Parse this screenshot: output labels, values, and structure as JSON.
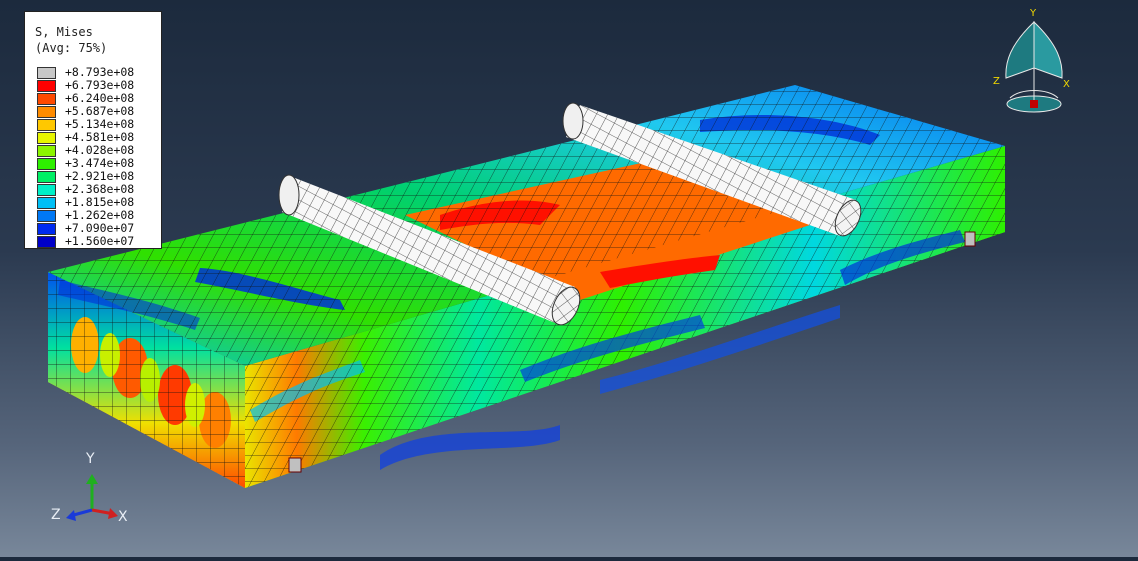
{
  "legend": {
    "title": "S, Mises",
    "subtitle": "(Avg: 75%)",
    "entries": [
      {
        "label": "+8.793e+08",
        "color": "#c8c8c8"
      },
      {
        "label": "+6.793e+08",
        "color": "#ff0000"
      },
      {
        "label": "+6.240e+08",
        "color": "#ff4a00"
      },
      {
        "label": "+5.687e+08",
        "color": "#ff8c00"
      },
      {
        "label": "+5.134e+08",
        "color": "#ffc800"
      },
      {
        "label": "+4.581e+08",
        "color": "#e6f500"
      },
      {
        "label": "+4.028e+08",
        "color": "#8cf500"
      },
      {
        "label": "+3.474e+08",
        "color": "#2ef000"
      },
      {
        "label": "+2.921e+08",
        "color": "#00f065"
      },
      {
        "label": "+2.368e+08",
        "color": "#00f0c8"
      },
      {
        "label": "+1.815e+08",
        "color": "#00bff5"
      },
      {
        "label": "+1.262e+08",
        "color": "#0078f5"
      },
      {
        "label": "+7.090e+07",
        "color": "#002bf0"
      },
      {
        "label": "+1.560e+07",
        "color": "#0000c8"
      }
    ]
  },
  "triad": {
    "y": "Y",
    "x": "X",
    "z": "Z"
  },
  "viewcube": {
    "y": "Y",
    "x": "X",
    "z": "Z"
  }
}
